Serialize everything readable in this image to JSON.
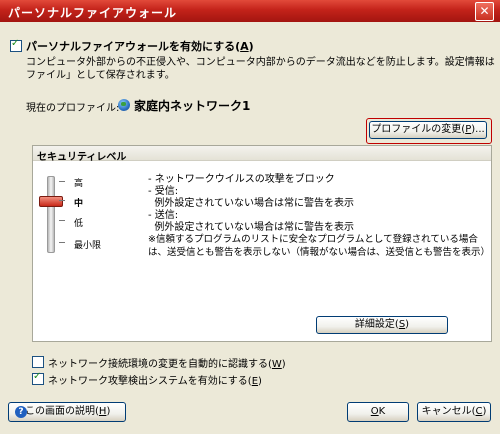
{
  "window": {
    "title": "パーソナルファイアウォール",
    "close_glyph": "✕"
  },
  "enable": {
    "label": "パーソナルファイアウォールを有効にする(",
    "accel": "A",
    "label_end": ")",
    "desc1": "コンピュータ外部からの不正侵入や、コンピュータ内部からのデータ流出などを防止します。設定情報は「プロ",
    "desc2": "ファイル」として保存されます。"
  },
  "profile": {
    "label": "現在のプロファイル:",
    "name": "家庭内ネットワーク1",
    "icon": "globe-icon",
    "change_button": "プロファイルの変更(",
    "change_accel": "P",
    "change_end": ")..."
  },
  "security": {
    "heading": "セキュリティレベル",
    "levels": [
      "高",
      "中",
      "低",
      "最小限"
    ],
    "selected_level": "中",
    "desc": [
      "- ネットワークウイルスの攻撃をブロック",
      "- 受信:",
      "  例外設定されていない場合は常に警告を表示",
      "- 送信:",
      "  例外設定されていない場合は常に警告を表示",
      "※信頼するプログラムのリストに安全なプログラムとして登録されている場合",
      "は、送受信とも警告を表示しない（情報がない場合は、送受信とも警告を表示）"
    ],
    "detail_button": "詳細設定(",
    "detail_accel": "S",
    "detail_end": ")"
  },
  "options": [
    {
      "label": "ネットワーク接続環境の変更を自動的に認識する(",
      "accel": "W",
      "end": ")",
      "checked": false
    },
    {
      "label": "ネットワーク攻撃検出システムを有効にする(",
      "accel": "E",
      "end": ")",
      "checked": true
    }
  ],
  "footer": {
    "help_button": "この画面の説明(",
    "help_accel": "H",
    "help_end": ")",
    "help_icon": "?",
    "ok_accel": "O",
    "ok_rest": "K",
    "cancel_button": "キャンセル(",
    "cancel_accel": "C",
    "cancel_end": ")"
  },
  "colors": {
    "title_bar": "#c3231a",
    "highlight_border": "#c00000",
    "panel_bg": "#ffffff"
  }
}
